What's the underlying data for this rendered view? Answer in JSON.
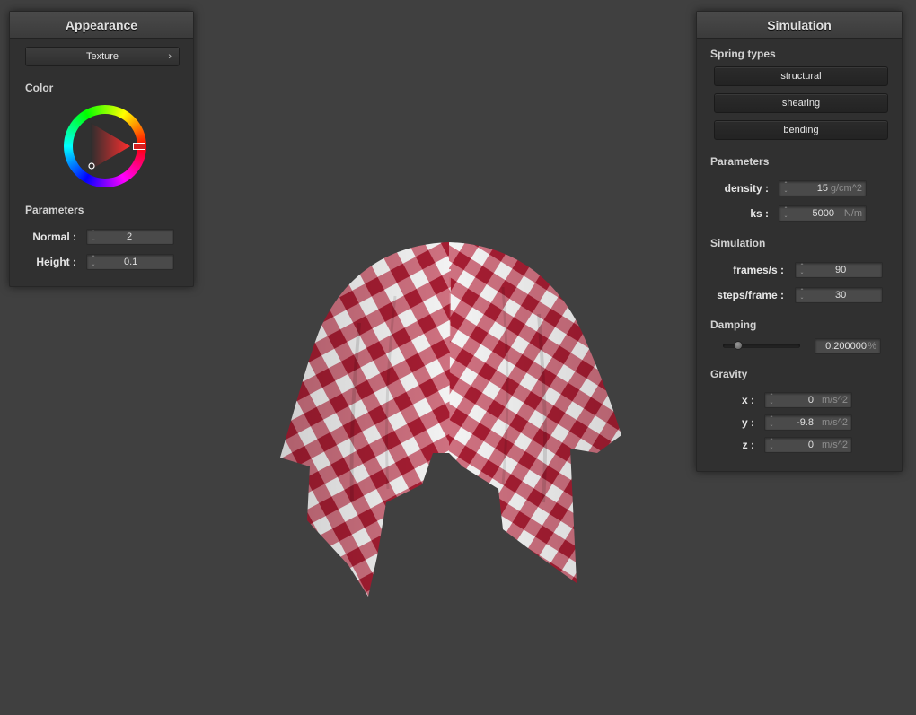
{
  "appearance": {
    "title": "Appearance",
    "texture_label": "Texture",
    "texture_chevron": "›",
    "color_label": "Color",
    "color_accent": "#ff0000",
    "parameters_label": "Parameters",
    "normal_label": "Normal :",
    "normal_value": "2",
    "height_label": "Height :",
    "height_value": "0.1"
  },
  "simulation": {
    "title": "Simulation",
    "spring_types_label": "Spring types",
    "spring_buttons": [
      "structural",
      "shearing",
      "bending"
    ],
    "parameters_label": "Parameters",
    "density_label": "density :",
    "density_value": "15",
    "density_unit": "g/cm^2",
    "ks_label": "ks :",
    "ks_value": "5000",
    "ks_unit": "N/m",
    "simulation_label": "Simulation",
    "fps_label": "frames/s :",
    "fps_value": "90",
    "steps_label": "steps/frame :",
    "steps_value": "30",
    "damping_label": "Damping",
    "damping_value": "0.200000",
    "damping_unit": "%",
    "damping_fraction": 0.2,
    "gravity_label": "Gravity",
    "gx_label": "x :",
    "gx_value": "0",
    "gy_label": "y :",
    "gy_value": "-9.8",
    "gz_label": "z :",
    "gz_value": "0",
    "gravity_unit": "m/s^2"
  },
  "scene": {
    "cloth_color_primary": "#a51d32",
    "cloth_color_secondary": "#f2f2f2",
    "background": "#404040"
  }
}
